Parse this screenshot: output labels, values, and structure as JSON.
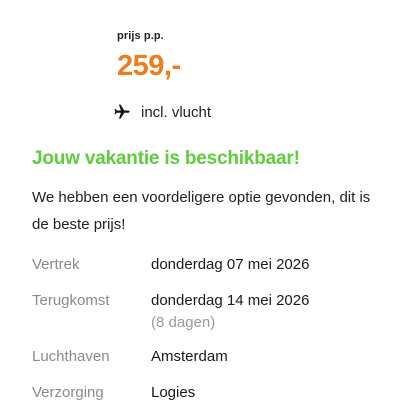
{
  "price": {
    "label": "prijs p.p.",
    "value": "259,-"
  },
  "flight": {
    "icon": "airplane-icon",
    "text": "incl. vlucht"
  },
  "availability": {
    "headline": "Jouw vakantie is beschikbaar!",
    "description": "We hebben een voordeligere optie gevonden, dit is de beste prijs!"
  },
  "details": {
    "departure": {
      "label": "Vertrek",
      "value": "donderdag 07 mei 2026"
    },
    "return": {
      "label": "Terugkomst",
      "value": "donderdag 14 mei 2026",
      "duration": "(8 dagen)"
    },
    "airport": {
      "label": "Luchthaven",
      "value": "Amsterdam"
    },
    "board": {
      "label": "Verzorging",
      "value": "Logies"
    }
  },
  "colors": {
    "price": "#f07c1c",
    "headline": "#5fcc3e",
    "muted": "#8a8a8a"
  }
}
